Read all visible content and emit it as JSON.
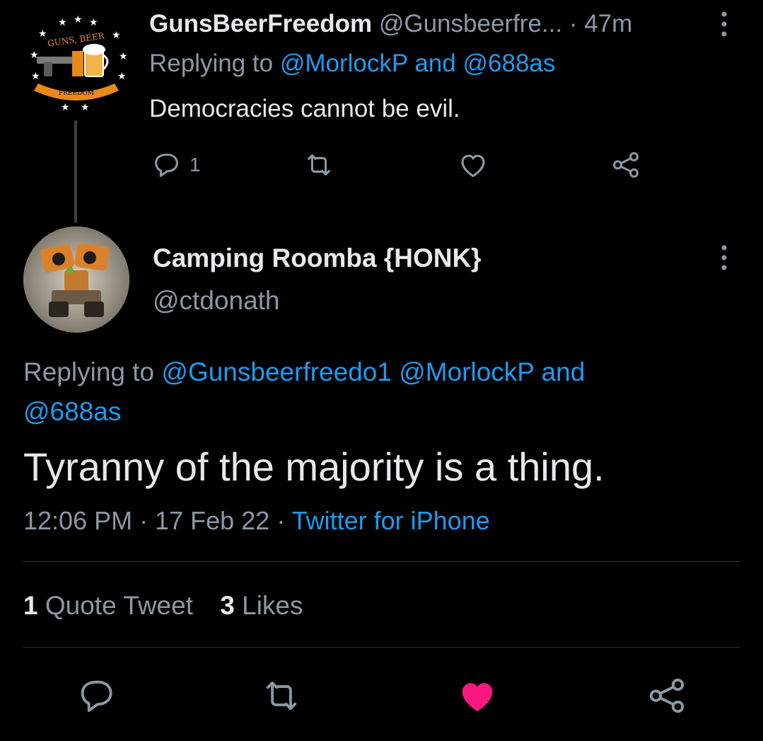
{
  "parent_tweet": {
    "display_name": "GunsBeerFreedom",
    "handle": "@Gunsbeerfre...",
    "separator": "·",
    "time_ago": "47m",
    "replying_label": "Replying to",
    "replying_mention_1": "@MorlockP",
    "replying_and": "and",
    "replying_mention_2": "@688as",
    "text": "Democracies cannot be evil.",
    "reply_count": "1",
    "avatar_text_top": "GUNS, BEER",
    "avatar_text_bottom": "FREEDOM"
  },
  "main_tweet": {
    "display_name": "Camping Roomba {HONK}",
    "handle": "@ctdonath",
    "replying_label": "Replying to",
    "replying_mention_1": "@Gunsbeerfreedo1",
    "replying_mention_2": "@MorlockP",
    "replying_and": "and",
    "replying_mention_3": "@688as",
    "text": "Tyranny of the majority is a thing.",
    "time": "12:06 PM",
    "date": "17 Feb 22",
    "meta_separator": "·",
    "source": "Twitter for iPhone",
    "quote_count": "1",
    "quote_label": "Quote Tweet",
    "likes_count": "3",
    "likes_label": "Likes",
    "liked": true
  },
  "colors": {
    "background": "#000000",
    "text": "#e7e9ea",
    "muted": "#8b98a5",
    "link": "#1d9bf0",
    "like_active": "#f91880",
    "divider": "#2f3336"
  },
  "icons": {
    "reply": "reply-icon",
    "retweet": "retweet-icon",
    "like": "heart-icon",
    "share": "share-icon",
    "more": "more-dots-icon"
  }
}
